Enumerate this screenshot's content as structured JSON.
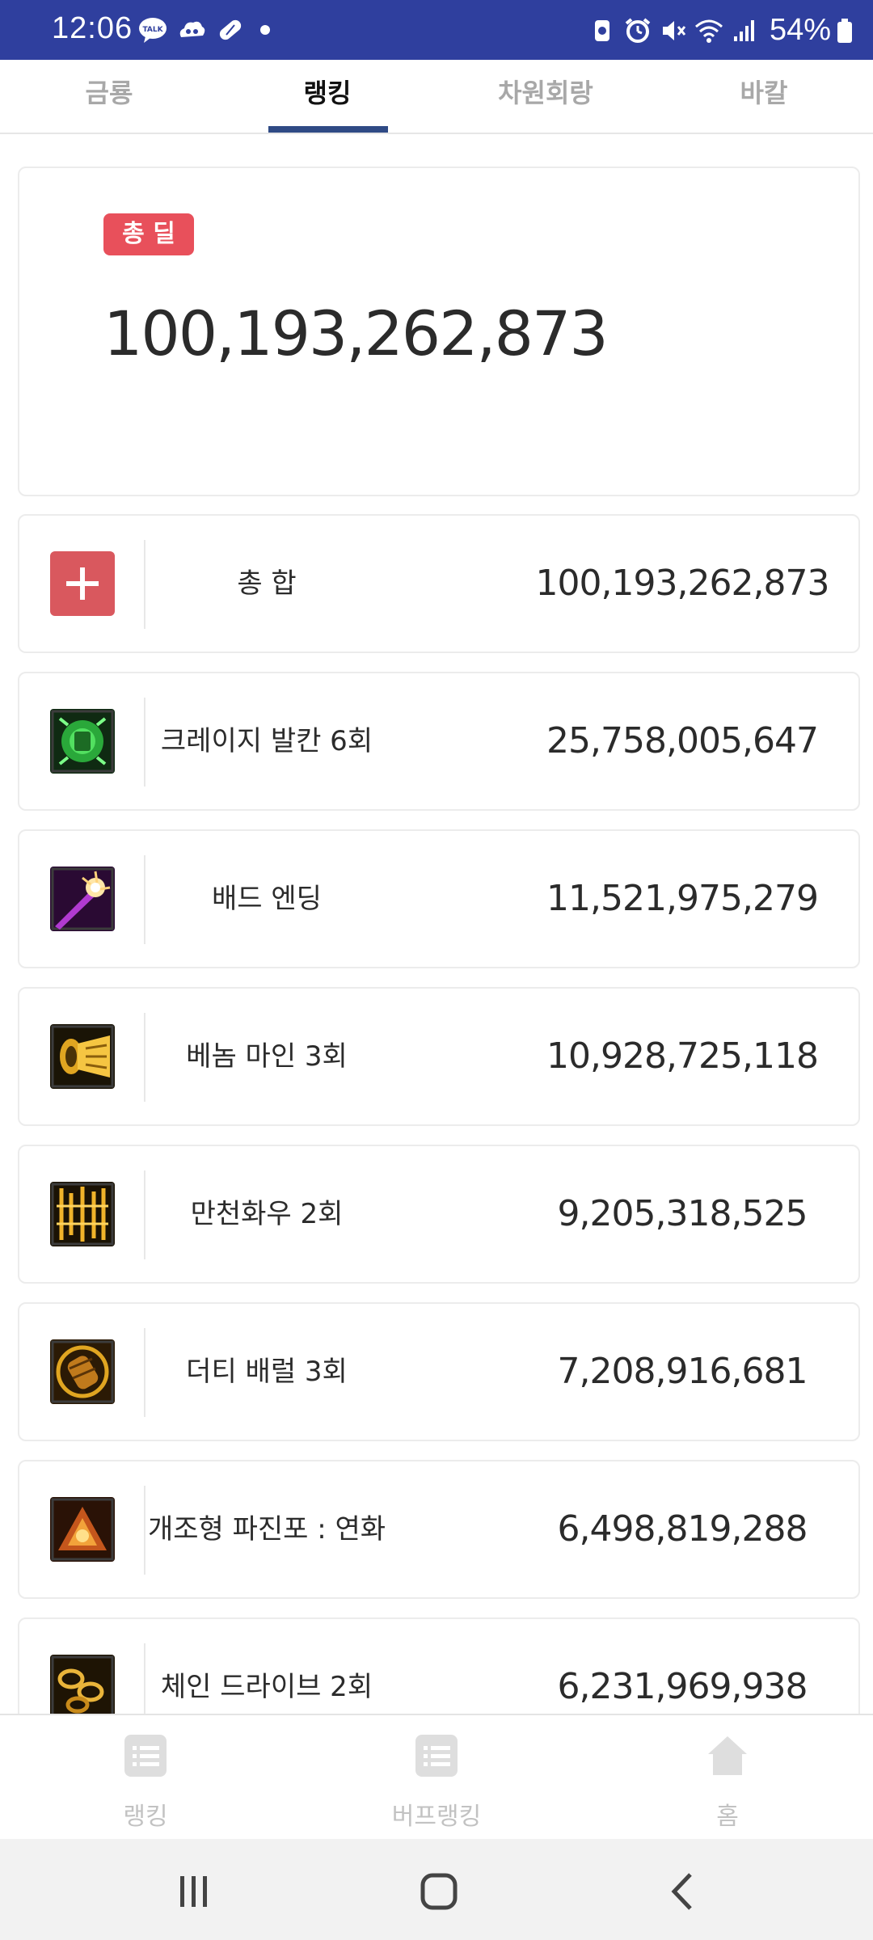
{
  "status_bar": {
    "time": "12:06",
    "battery_text": "54%",
    "left_icons": [
      "talk-icon",
      "cloud-icon",
      "pill-icon",
      "dot-icon"
    ],
    "right_icons": [
      "shield-icon",
      "alarm-icon",
      "mute-icon",
      "wifi-icon",
      "signal-icon",
      "battery-icon"
    ]
  },
  "tabs": [
    {
      "label": "금룡",
      "active": false
    },
    {
      "label": "랭킹",
      "active": true
    },
    {
      "label": "차원회랑",
      "active": false
    },
    {
      "label": "바칼",
      "active": false
    }
  ],
  "total": {
    "badge": "총 딜",
    "value": "100,193,262,873"
  },
  "skills": [
    {
      "name": "총 합",
      "value": "100,193,262,873",
      "icon": "plus-icon"
    },
    {
      "name": "크레이지 발칸 6회",
      "value": "25,758,005,647",
      "icon": "crazy-vulcan-icon"
    },
    {
      "name": "배드 엔딩",
      "value": "11,521,975,279",
      "icon": "bad-ending-icon"
    },
    {
      "name": "베놈 마인 3회",
      "value": "10,928,725,118",
      "icon": "venom-mine-icon"
    },
    {
      "name": "만천화우 2회",
      "value": "9,205,318,525",
      "icon": "flower-rain-icon"
    },
    {
      "name": "더티 배럴 3회",
      "value": "7,208,916,681",
      "icon": "dirty-barrel-icon"
    },
    {
      "name": "개조형 파진포 : 연화",
      "value": "6,498,819,288",
      "icon": "modified-cannon-icon"
    },
    {
      "name": "체인 드라이브 2회",
      "value": "6,231,969,938",
      "icon": "chain-drive-icon"
    }
  ],
  "bottom_nav": [
    {
      "label": "랭킹",
      "icon": "list-icon"
    },
    {
      "label": "버프랭킹",
      "icon": "list-icon"
    },
    {
      "label": "홈",
      "icon": "home-icon"
    }
  ],
  "colors": {
    "status_bar": "#2f3f9e",
    "badge": "#e8505b",
    "tab_indicator": "#2f4a85",
    "plus_icon": "#d9585e"
  }
}
